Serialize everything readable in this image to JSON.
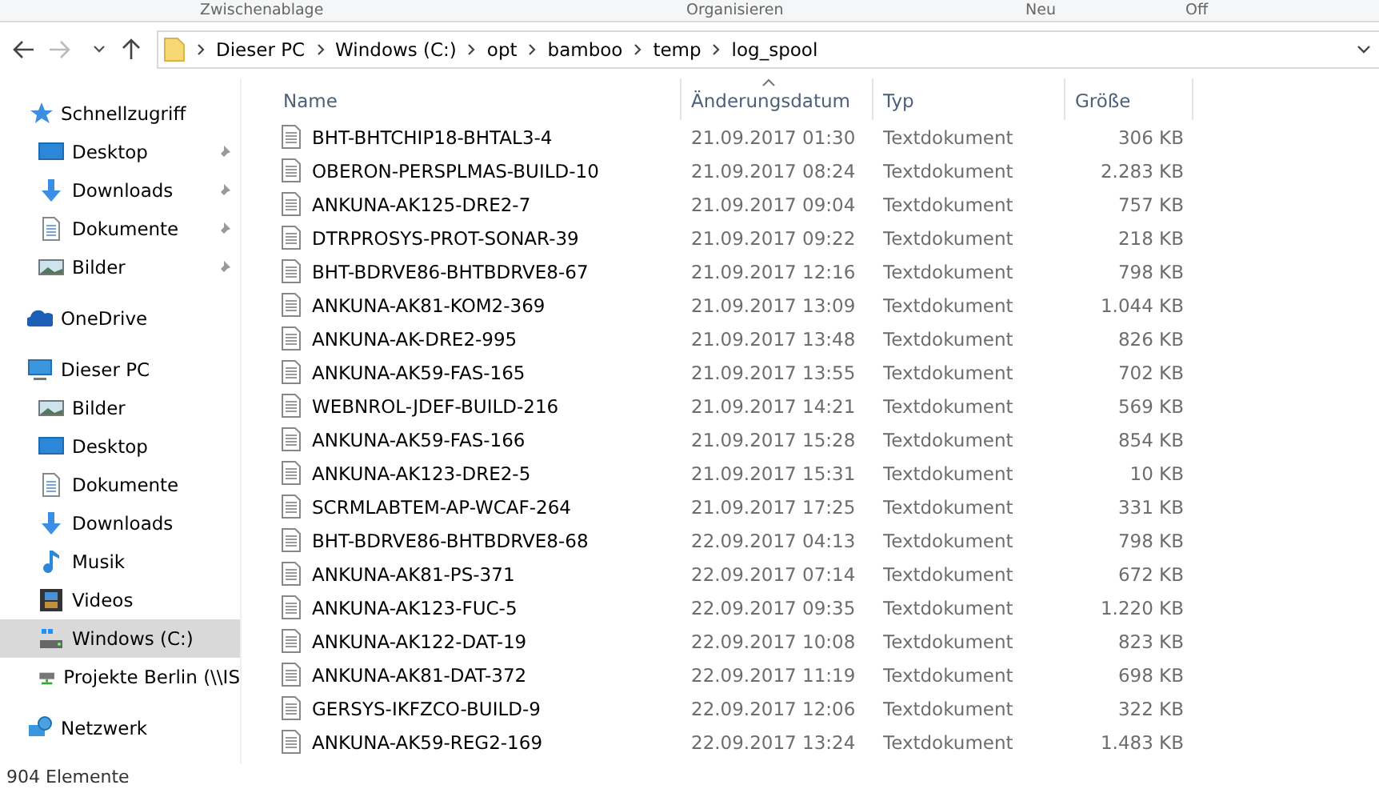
{
  "ribbon_groups": [
    "Zwischenablage",
    "Organisieren",
    "Neu",
    "Off"
  ],
  "navigation": {
    "back_disabled": false,
    "forward_disabled": true
  },
  "address_bar": {
    "breadcrumbs": [
      "Dieser PC",
      "Windows (C:)",
      "opt",
      "bamboo",
      "temp",
      "log_spool"
    ]
  },
  "sidebar": {
    "groups": [
      {
        "label": "Schnellzugriff",
        "kind": "star",
        "selected": false,
        "children": [
          {
            "label": "Desktop",
            "kind": "desktop",
            "pinned": true,
            "selected": false
          },
          {
            "label": "Downloads",
            "kind": "download",
            "pinned": true,
            "selected": false
          },
          {
            "label": "Dokumente",
            "kind": "document",
            "pinned": true,
            "selected": false
          },
          {
            "label": "Bilder",
            "kind": "picture",
            "pinned": true,
            "selected": false
          }
        ]
      },
      {
        "label": "OneDrive",
        "kind": "cloud",
        "selected": false
      },
      {
        "label": "Dieser PC",
        "kind": "computer",
        "selected": false,
        "children": [
          {
            "label": "Bilder",
            "kind": "picture",
            "pinned": false,
            "selected": false
          },
          {
            "label": "Desktop",
            "kind": "desktop",
            "pinned": false,
            "selected": false
          },
          {
            "label": "Dokumente",
            "kind": "document",
            "pinned": false,
            "selected": false
          },
          {
            "label": "Downloads",
            "kind": "download",
            "pinned": false,
            "selected": false
          },
          {
            "label": "Musik",
            "kind": "music",
            "pinned": false,
            "selected": false
          },
          {
            "label": "Videos",
            "kind": "video",
            "pinned": false,
            "selected": false
          },
          {
            "label": "Windows (C:)",
            "kind": "drive",
            "pinned": false,
            "selected": true
          },
          {
            "label": "Projekte Berlin (\\\\IS",
            "kind": "netdrive",
            "pinned": false,
            "selected": false
          }
        ]
      },
      {
        "label": "Netzwerk",
        "kind": "network",
        "selected": false
      }
    ]
  },
  "table": {
    "columns": [
      {
        "label": "Name",
        "sorted": false
      },
      {
        "label": "Änderungsdatum",
        "sorted": true
      },
      {
        "label": "Typ",
        "sorted": false
      },
      {
        "label": "Größe",
        "sorted": false
      }
    ],
    "rows": [
      [
        "BHT-BHTCHIP18-BHTAL3-4",
        "21.09.2017 01:30",
        "Textdokument",
        "306 KB"
      ],
      [
        "OBERON-PERSPLMAS-BUILD-10",
        "21.09.2017 08:24",
        "Textdokument",
        "2.283 KB"
      ],
      [
        "ANKUNA-AK125-DRE2-7",
        "21.09.2017 09:04",
        "Textdokument",
        "757 KB"
      ],
      [
        "DTRPROSYS-PROT-SONAR-39",
        "21.09.2017 09:22",
        "Textdokument",
        "218 KB"
      ],
      [
        "BHT-BDRVE86-BHTBDRVE8-67",
        "21.09.2017 12:16",
        "Textdokument",
        "798 KB"
      ],
      [
        "ANKUNA-AK81-KOM2-369",
        "21.09.2017 13:09",
        "Textdokument",
        "1.044 KB"
      ],
      [
        "ANKUNA-AK-DRE2-995",
        "21.09.2017 13:48",
        "Textdokument",
        "826 KB"
      ],
      [
        "ANKUNA-AK59-FAS-165",
        "21.09.2017 13:55",
        "Textdokument",
        "702 KB"
      ],
      [
        "WEBNROL-JDEF-BUILD-216",
        "21.09.2017 14:21",
        "Textdokument",
        "569 KB"
      ],
      [
        "ANKUNA-AK59-FAS-166",
        "21.09.2017 15:28",
        "Textdokument",
        "854 KB"
      ],
      [
        "ANKUNA-AK123-DRE2-5",
        "21.09.2017 15:31",
        "Textdokument",
        "10 KB"
      ],
      [
        "SCRMLABTEM-AP-WCAF-264",
        "21.09.2017 17:25",
        "Textdokument",
        "331 KB"
      ],
      [
        "BHT-BDRVE86-BHTBDRVE8-68",
        "22.09.2017 04:13",
        "Textdokument",
        "798 KB"
      ],
      [
        "ANKUNA-AK81-PS-371",
        "22.09.2017 07:14",
        "Textdokument",
        "672 KB"
      ],
      [
        "ANKUNA-AK123-FUC-5",
        "22.09.2017 09:35",
        "Textdokument",
        "1.220 KB"
      ],
      [
        "ANKUNA-AK122-DAT-19",
        "22.09.2017 10:08",
        "Textdokument",
        "823 KB"
      ],
      [
        "ANKUNA-AK81-DAT-372",
        "22.09.2017 11:19",
        "Textdokument",
        "698 KB"
      ],
      [
        "GERSYS-IKFZCO-BUILD-9",
        "22.09.2017 12:06",
        "Textdokument",
        "322 KB"
      ],
      [
        "ANKUNA-AK59-REG2-169",
        "22.09.2017 13:24",
        "Textdokument",
        "1.483 KB"
      ]
    ]
  },
  "status_bar": "904 Elemente"
}
